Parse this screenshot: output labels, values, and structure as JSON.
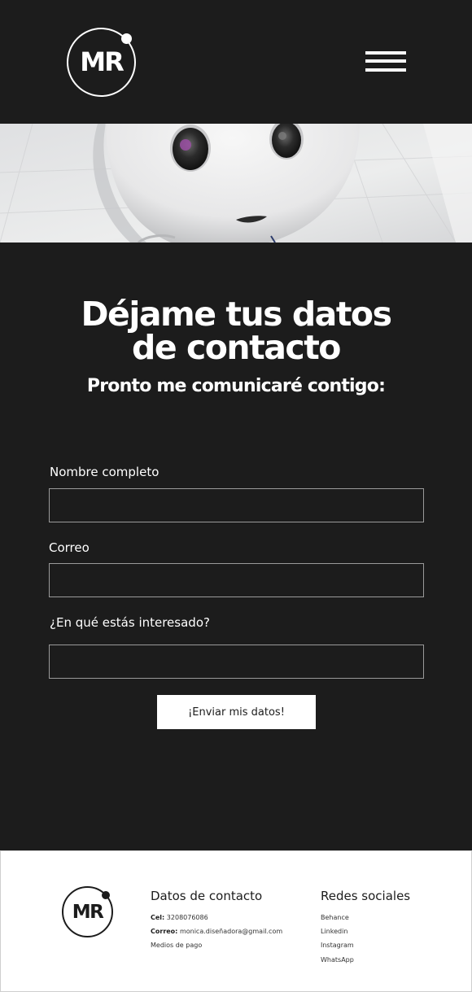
{
  "header": {
    "logo_text": "MR",
    "menu_icon": "hamburger-menu-icon"
  },
  "hero": {
    "image": "robot-face-photo"
  },
  "contact": {
    "title_line1": "Déjame tus datos",
    "title_line2": "de contacto",
    "subtitle": "Pronto me comunicaré contigo:",
    "fields": [
      {
        "label": "Nombre completo",
        "value": ""
      },
      {
        "label": "Correo",
        "value": ""
      },
      {
        "label": "¿En qué estás interesado?",
        "value": ""
      }
    ],
    "submit_label": "¡Enviar mis datos!"
  },
  "footer": {
    "logo_text": "MR",
    "contact_heading": "Datos de contacto",
    "phone_label": "Cel:",
    "phone_value": "3208076086",
    "email_label": "Correo:",
    "email_value": "monica.diseñadora@gmail.com",
    "payment_link": "Medios de pago",
    "social_heading": "Redes sociales",
    "social_links": [
      "Behance",
      "Linkedin",
      "Instagram",
      "WhatsApp"
    ]
  },
  "colors": {
    "background": "#1c1c1c",
    "foreground": "#ffffff",
    "footer_background": "#ffffff"
  }
}
